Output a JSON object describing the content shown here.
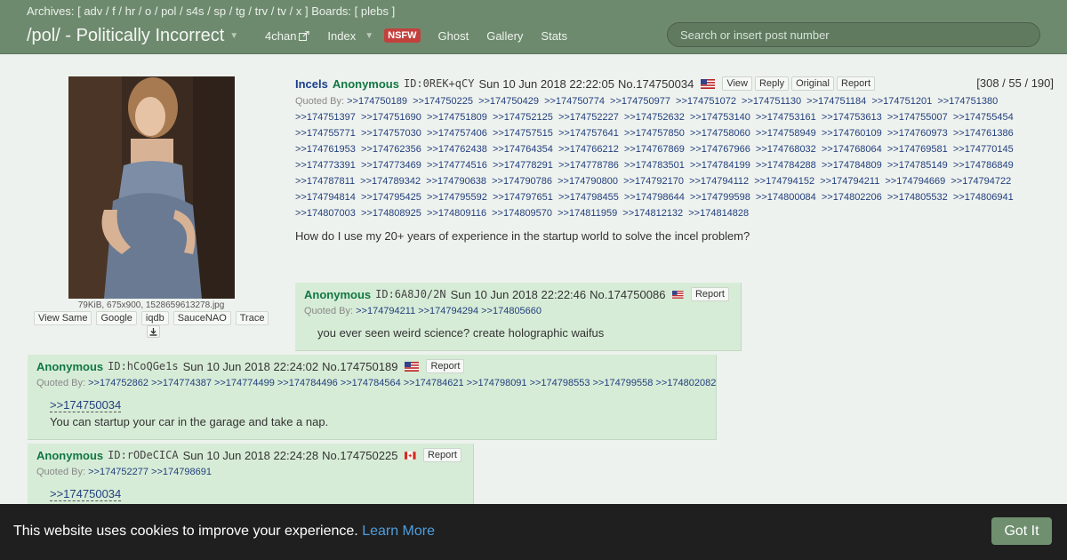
{
  "header": {
    "archives_label": "Archives:",
    "archives": [
      "adv",
      "f",
      "hr",
      "o",
      "pol",
      "s4s",
      "sp",
      "tg",
      "trv",
      "tv",
      "x"
    ],
    "boards_label": "Boards:",
    "boards": [
      "plebs"
    ],
    "board_title": "/pol/ - Politically Incorrect",
    "nav": {
      "fourchan": "4chan",
      "index": "Index",
      "nsfw": "NSFW",
      "ghost": "Ghost",
      "gallery": "Gallery",
      "stats": "Stats"
    },
    "search_placeholder": "Search or insert post number"
  },
  "op": {
    "file_meta": "79KiB, 675x900, 1528659613278.jpg",
    "image_tools": [
      "View Same",
      "Google",
      "iqdb",
      "SauceNAO",
      "Trace"
    ],
    "subject": "Incels",
    "name": "Anonymous",
    "id": "ID:0REK+qCY",
    "time": "Sun 10 Jun 2018 22:22:05",
    "postno": "No.174750034",
    "buttons": {
      "view": "View",
      "reply": "Reply",
      "original": "Original",
      "report": "Report"
    },
    "stats": "[308 / 55 / 190]",
    "quoted_label": "Quoted By:",
    "quoted_by": [
      ">>174750189",
      ">>174750225",
      ">>174750429",
      ">>174750774",
      ">>174750977",
      ">>174751072",
      ">>174751130",
      ">>174751184",
      ">>174751201",
      ">>174751380",
      ">>174751397",
      ">>174751690",
      ">>174751809",
      ">>174752125",
      ">>174752227",
      ">>174752632",
      ">>174753140",
      ">>174753161",
      ">>174753613",
      ">>174755007",
      ">>174755454",
      ">>174755771",
      ">>174757030",
      ">>174757406",
      ">>174757515",
      ">>174757641",
      ">>174757850",
      ">>174758060",
      ">>174758949",
      ">>174760109",
      ">>174760973",
      ">>174761386",
      ">>174761953",
      ">>174762356",
      ">>174762438",
      ">>174764354",
      ">>174766212",
      ">>174767869",
      ">>174767966",
      ">>174768032",
      ">>174768064",
      ">>174769581",
      ">>174770145",
      ">>174773391",
      ">>174773469",
      ">>174774516",
      ">>174778291",
      ">>174778786",
      ">>174783501",
      ">>174784199",
      ">>174784288",
      ">>174784809",
      ">>174785149",
      ">>174786849",
      ">>174787811",
      ">>174789342",
      ">>174790638",
      ">>174790786",
      ">>174790800",
      ">>174792170",
      ">>174794112",
      ">>174794152",
      ">>174794211",
      ">>174794669",
      ">>174794722",
      ">>174794814",
      ">>174795425",
      ">>174795592",
      ">>174797651",
      ">>174798455",
      ">>174798644",
      ">>174799598",
      ">>174800084",
      ">>174802206",
      ">>174805532",
      ">>174806941",
      ">>174807003",
      ">>174808925",
      ">>174809116",
      ">>174809570",
      ">>174811959",
      ">>174812132",
      ">>174814828"
    ],
    "text": "How do I use my 20+ years of experience in the startup world to solve the incel problem?"
  },
  "replies": [
    {
      "name": "Anonymous",
      "id": "ID:6A8J0/2N",
      "time": "Sun 10 Jun 2018 22:22:46",
      "postno": "No.174750086",
      "flag": "us-flag-icon",
      "report": "Report",
      "quoted_label": "Quoted By:",
      "quoted_by": [
        ">>174794211",
        ">>174794294",
        ">>174805660"
      ],
      "quote_link": "",
      "text": "you ever seen weird science? create holographic waifus"
    },
    {
      "name": "Anonymous",
      "id": "ID:hCoQGe1s",
      "time": "Sun 10 Jun 2018 22:24:02",
      "postno": "No.174750189",
      "flag": "us-flag-icon",
      "report": "Report",
      "quoted_label": "Quoted By:",
      "quoted_by": [
        ">>174752862",
        ">>174774387",
        ">>174774499",
        ">>174784496",
        ">>174784564",
        ">>174784621",
        ">>174798091",
        ">>174798553",
        ">>174799558",
        ">>174802082"
      ],
      "quote_link": ">>174750034",
      "text": "You can startup your car in the garage and take a nap."
    },
    {
      "name": "Anonymous",
      "id": "ID:rODeCICA",
      "time": "Sun 10 Jun 2018 22:24:28",
      "postno": "No.174750225",
      "flag": "ca-flag-icon",
      "report": "Report",
      "quoted_label": "Quoted By:",
      "quoted_by": [
        ">>174752277",
        ">>174798691"
      ],
      "quote_link": ">>174750034",
      "text": ""
    }
  ],
  "cookie": {
    "message": "This website uses cookies to improve your experience.",
    "learn_more": "Learn More",
    "button": "Got It"
  },
  "colors": {
    "header_bg": "#6e8a6e",
    "reply_bg": "#d7ecd7",
    "name": "#117743",
    "subject": "#1a3f8e",
    "link": "#23407e"
  }
}
